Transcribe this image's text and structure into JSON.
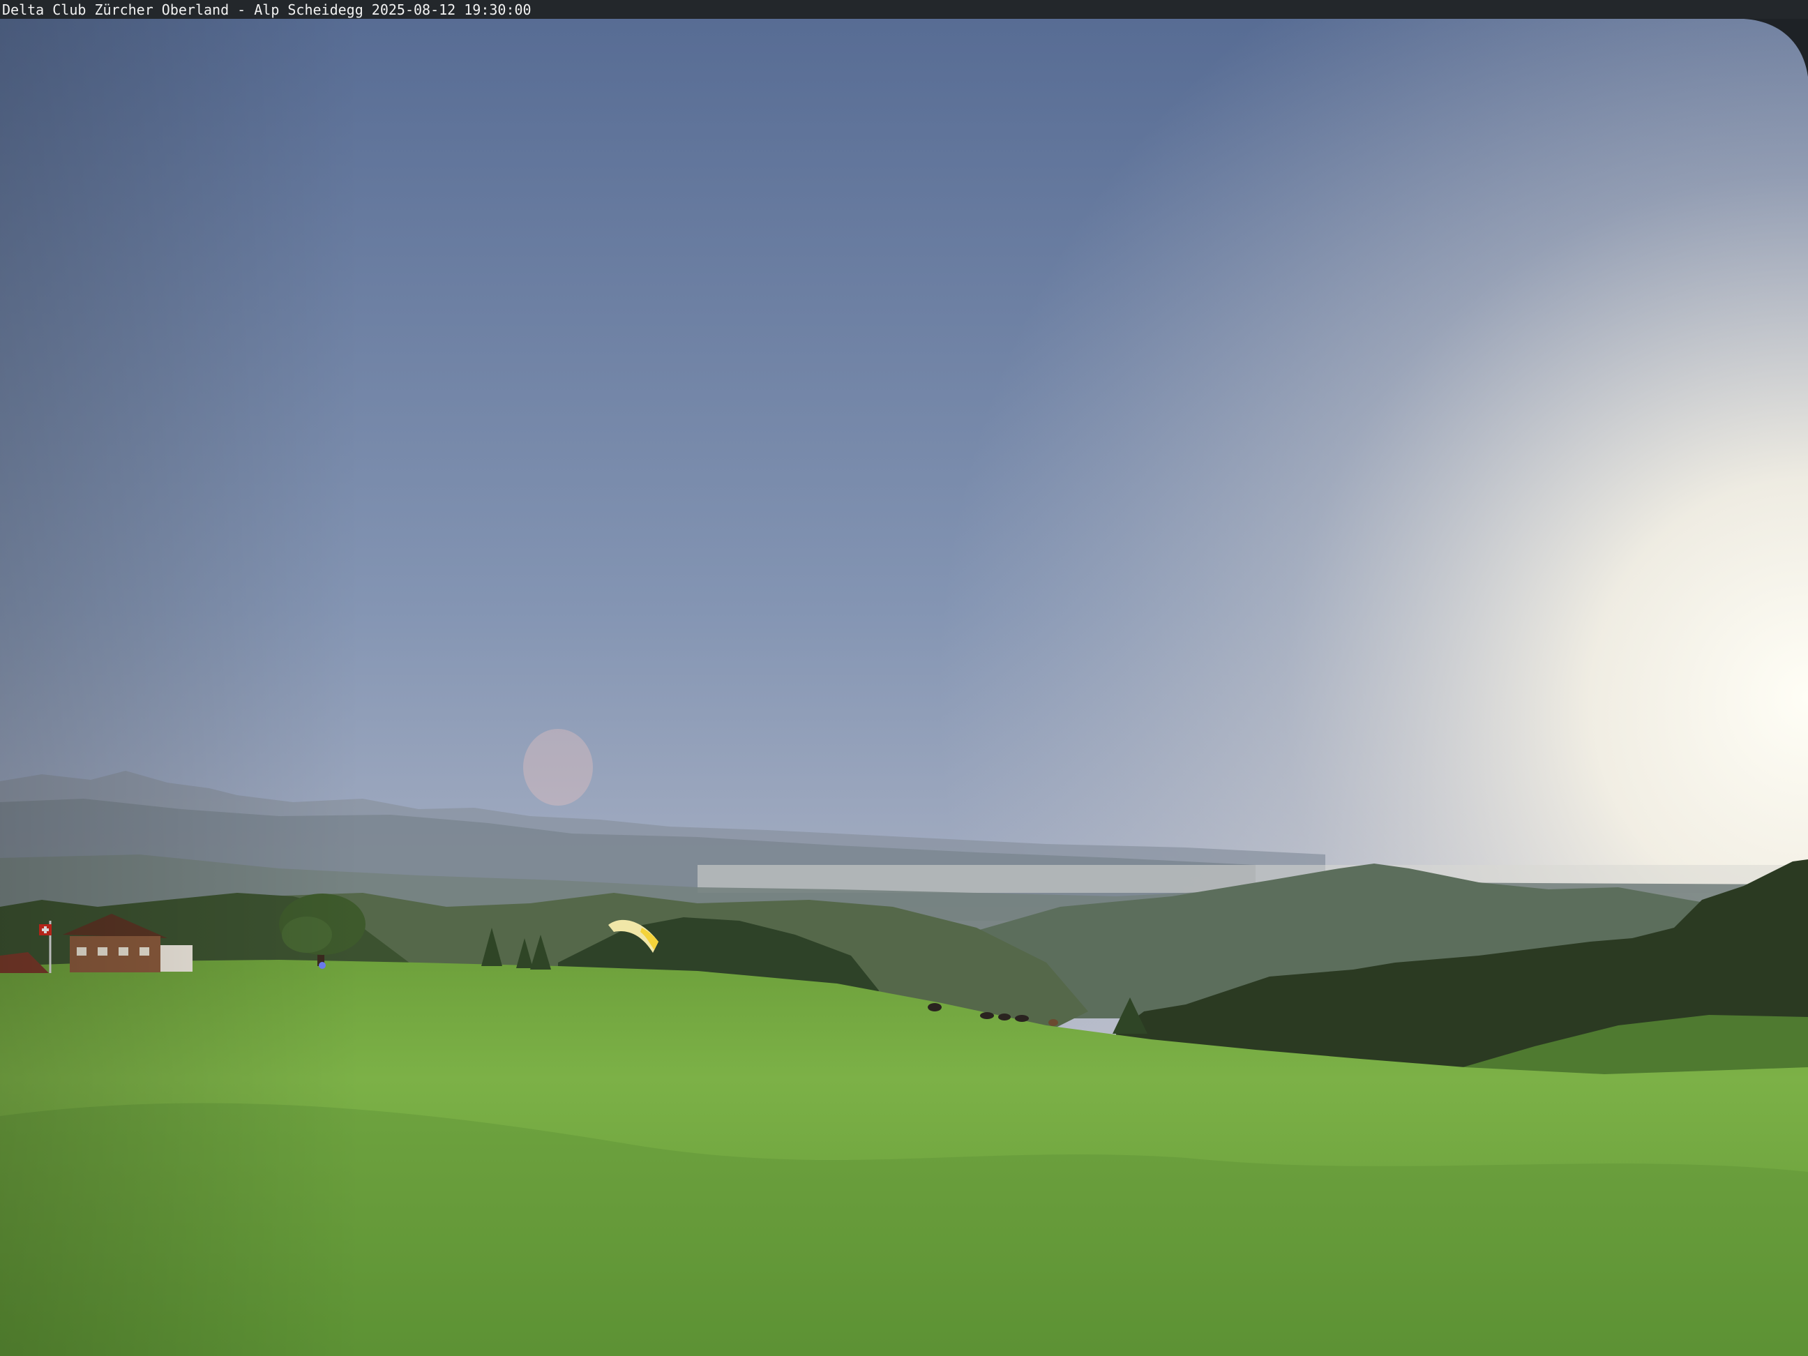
{
  "caption": {
    "text": "Delta Club Zürcher Oberland - Alp Scheidegg 2025-08-12 19:30:00"
  },
  "scene": {
    "description_icons": [
      "sky",
      "alps-range",
      "lake",
      "forest-hill",
      "farmhouse",
      "swiss-flag",
      "tree",
      "paraglider",
      "cows",
      "meadow"
    ],
    "colors": {
      "sky_top": "#5b7096",
      "sky_mid": "#8e9fba",
      "sky_horizon": "#ddd8d6",
      "sun_glow": "#fffdf4",
      "grass_light": "#7fb24a",
      "grass_dark": "#55862f",
      "forest": "#2c3d24",
      "haze_hills": "#6d7a78",
      "flag_red": "#d52b1e"
    }
  }
}
